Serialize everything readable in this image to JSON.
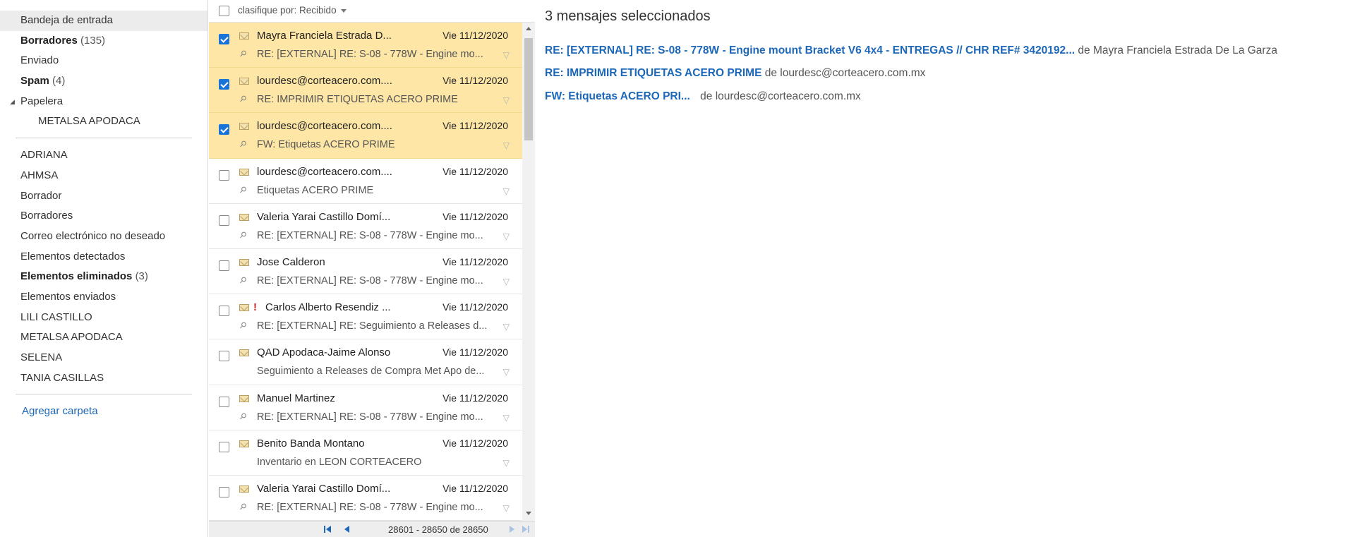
{
  "folders": {
    "primary": [
      {
        "name": "Bandeja de entrada",
        "count": "",
        "bold": false,
        "selected": true
      },
      {
        "name": "Borradores",
        "count": "(135)",
        "bold": true
      },
      {
        "name": "Enviado",
        "count": "",
        "bold": false
      },
      {
        "name": "Spam",
        "count": "(4)",
        "bold": true
      },
      {
        "name": "Papelera",
        "count": "",
        "bold": false,
        "expanded": true
      },
      {
        "name": "METALSA APODACA",
        "count": "",
        "bold": false,
        "sub": true
      }
    ],
    "custom": [
      {
        "name": "ADRIANA",
        "count": "",
        "bold": false
      },
      {
        "name": "AHMSA",
        "count": "",
        "bold": false
      },
      {
        "name": "Borrador",
        "count": "",
        "bold": false
      },
      {
        "name": "Borradores",
        "count": "",
        "bold": false
      },
      {
        "name": "Correo electrónico no deseado",
        "count": "",
        "bold": false
      },
      {
        "name": "Elementos detectados",
        "count": "",
        "bold": false
      },
      {
        "name": "Elementos eliminados",
        "count": "(3)",
        "bold": true
      },
      {
        "name": "Elementos enviados",
        "count": "",
        "bold": false
      },
      {
        "name": "LILI CASTILLO",
        "count": "",
        "bold": false
      },
      {
        "name": "METALSA APODACA",
        "count": "",
        "bold": false
      },
      {
        "name": "SELENA",
        "count": "",
        "bold": false
      },
      {
        "name": "TANIA CASILLAS",
        "count": "",
        "bold": false
      }
    ],
    "add_folder_label": "Agregar carpeta"
  },
  "list": {
    "sort_label": "clasifique por: Recibido",
    "messages": [
      {
        "sender": "Mayra Franciela Estrada D...",
        "date": "Vie 11/12/2020",
        "subject": "RE: [EXTERNAL] RE: S-08 - 778W - Engine mo...",
        "attachment": true,
        "important": false,
        "selected": true
      },
      {
        "sender": "lourdesc@corteacero.com....",
        "date": "Vie 11/12/2020",
        "subject": "RE: IMPRIMIR ETIQUETAS ACERO PRIME",
        "attachment": true,
        "important": false,
        "selected": true
      },
      {
        "sender": "lourdesc@corteacero.com....",
        "date": "Vie 11/12/2020",
        "subject": "FW: Etiquetas ACERO PRIME",
        "attachment": true,
        "important": false,
        "selected": true
      },
      {
        "sender": "lourdesc@corteacero.com....",
        "date": "Vie 11/12/2020",
        "subject": "Etiquetas ACERO PRIME",
        "attachment": true,
        "important": false,
        "selected": false
      },
      {
        "sender": "Valeria Yarai Castillo Domí...",
        "date": "Vie 11/12/2020",
        "subject": "RE: [EXTERNAL] RE: S-08 - 778W - Engine mo...",
        "attachment": true,
        "important": false,
        "selected": false
      },
      {
        "sender": "Jose Calderon",
        "date": "Vie 11/12/2020",
        "subject": "RE: [EXTERNAL] RE: S-08 - 778W - Engine mo...",
        "attachment": true,
        "important": false,
        "selected": false
      },
      {
        "sender": "Carlos Alberto Resendiz ...",
        "date": "Vie 11/12/2020",
        "subject": "RE: [EXTERNAL] RE: Seguimiento a Releases d...",
        "attachment": true,
        "important": true,
        "selected": false
      },
      {
        "sender": "QAD Apodaca-Jaime Alonso",
        "date": "Vie 11/12/2020",
        "subject": "Seguimiento a Releases de Compra Met Apo de...",
        "attachment": false,
        "important": false,
        "selected": false
      },
      {
        "sender": "Manuel Martinez",
        "date": "Vie 11/12/2020",
        "subject": "RE: [EXTERNAL] RE: S-08 - 778W - Engine mo...",
        "attachment": true,
        "important": false,
        "selected": false
      },
      {
        "sender": "Benito Banda Montano",
        "date": "Vie 11/12/2020",
        "subject": "Inventario en LEON CORTEACERO",
        "attachment": false,
        "important": false,
        "selected": false
      },
      {
        "sender": "Valeria Yarai Castillo Domí...",
        "date": "Vie 11/12/2020",
        "subject": "RE: [EXTERNAL] RE: S-08 - 778W - Engine mo...",
        "attachment": true,
        "important": false,
        "selected": false
      }
    ],
    "pager_text": "28601 - 28650 de 28650"
  },
  "reading": {
    "title": "3 mensajes seleccionados",
    "items": [
      {
        "subject": "RE: [EXTERNAL] RE: S-08 - 778W - Engine mount Bracket V6 4x4 - ENTREGAS // CHR REF# 3420192...",
        "from": "de Mayra Franciela Estrada De La Garza"
      },
      {
        "subject": "RE: IMPRIMIR ETIQUETAS ACERO PRIME",
        "from": "de lourdesc@corteacero.com.mx"
      },
      {
        "subject": "FW: Etiquetas ACERO PRI...",
        "from": "de lourdesc@corteacero.com.mx"
      }
    ]
  },
  "colors": {
    "accent_blue": "#1c67b8",
    "selected_row": "#fde6a6",
    "checkbox_checked": "#1a73d9",
    "importance_red": "#d11f1f"
  }
}
